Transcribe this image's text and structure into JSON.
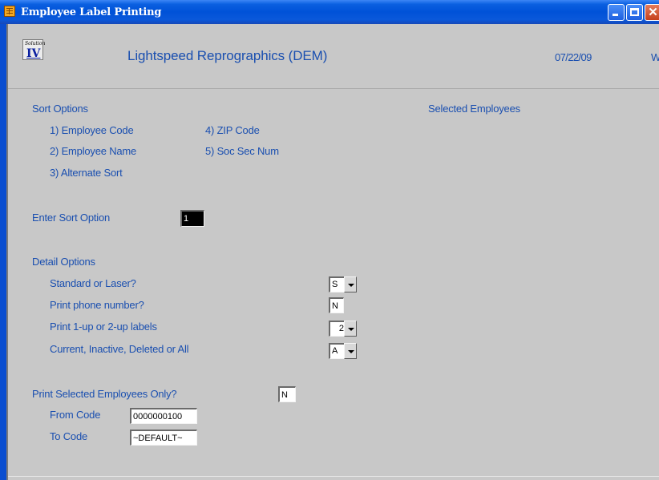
{
  "window": {
    "title": "Employee Label Printing"
  },
  "header": {
    "logo_small": "Solution",
    "logo_big": "IV",
    "company": "Lightspeed Reprographics (DEM)",
    "date": "07/22/09",
    "right_cut_text": "W"
  },
  "sort": {
    "heading": "Sort Options",
    "options": [
      "1) Employee Code",
      "2) Employee Name",
      "3) Alternate Sort",
      "4) ZIP Code",
      "5) Soc Sec Num"
    ],
    "enter_label": "Enter Sort Option",
    "enter_value": "1"
  },
  "selected_employees_label": "Selected Employees",
  "detail": {
    "heading": "Detail Options",
    "standard_or_laser": {
      "label": "Standard or Laser?",
      "value": "S"
    },
    "print_phone": {
      "label": "Print phone number?",
      "value": "N"
    },
    "print_up": {
      "label": "Print 1-up or 2-up labels",
      "value": "2"
    },
    "status": {
      "label": "Current, Inactive, Deleted or All",
      "value": "A"
    }
  },
  "selected_only": {
    "label": "Print Selected Employees Only?",
    "value": "N",
    "from_label": "From Code",
    "from_value": "0000000100",
    "to_label": "To Code",
    "to_value": "~DEFAULT~"
  },
  "colors": {
    "title_bar": "#0052d8",
    "label_text": "#1a4fb0",
    "client_bg": "#c8c8c8"
  }
}
